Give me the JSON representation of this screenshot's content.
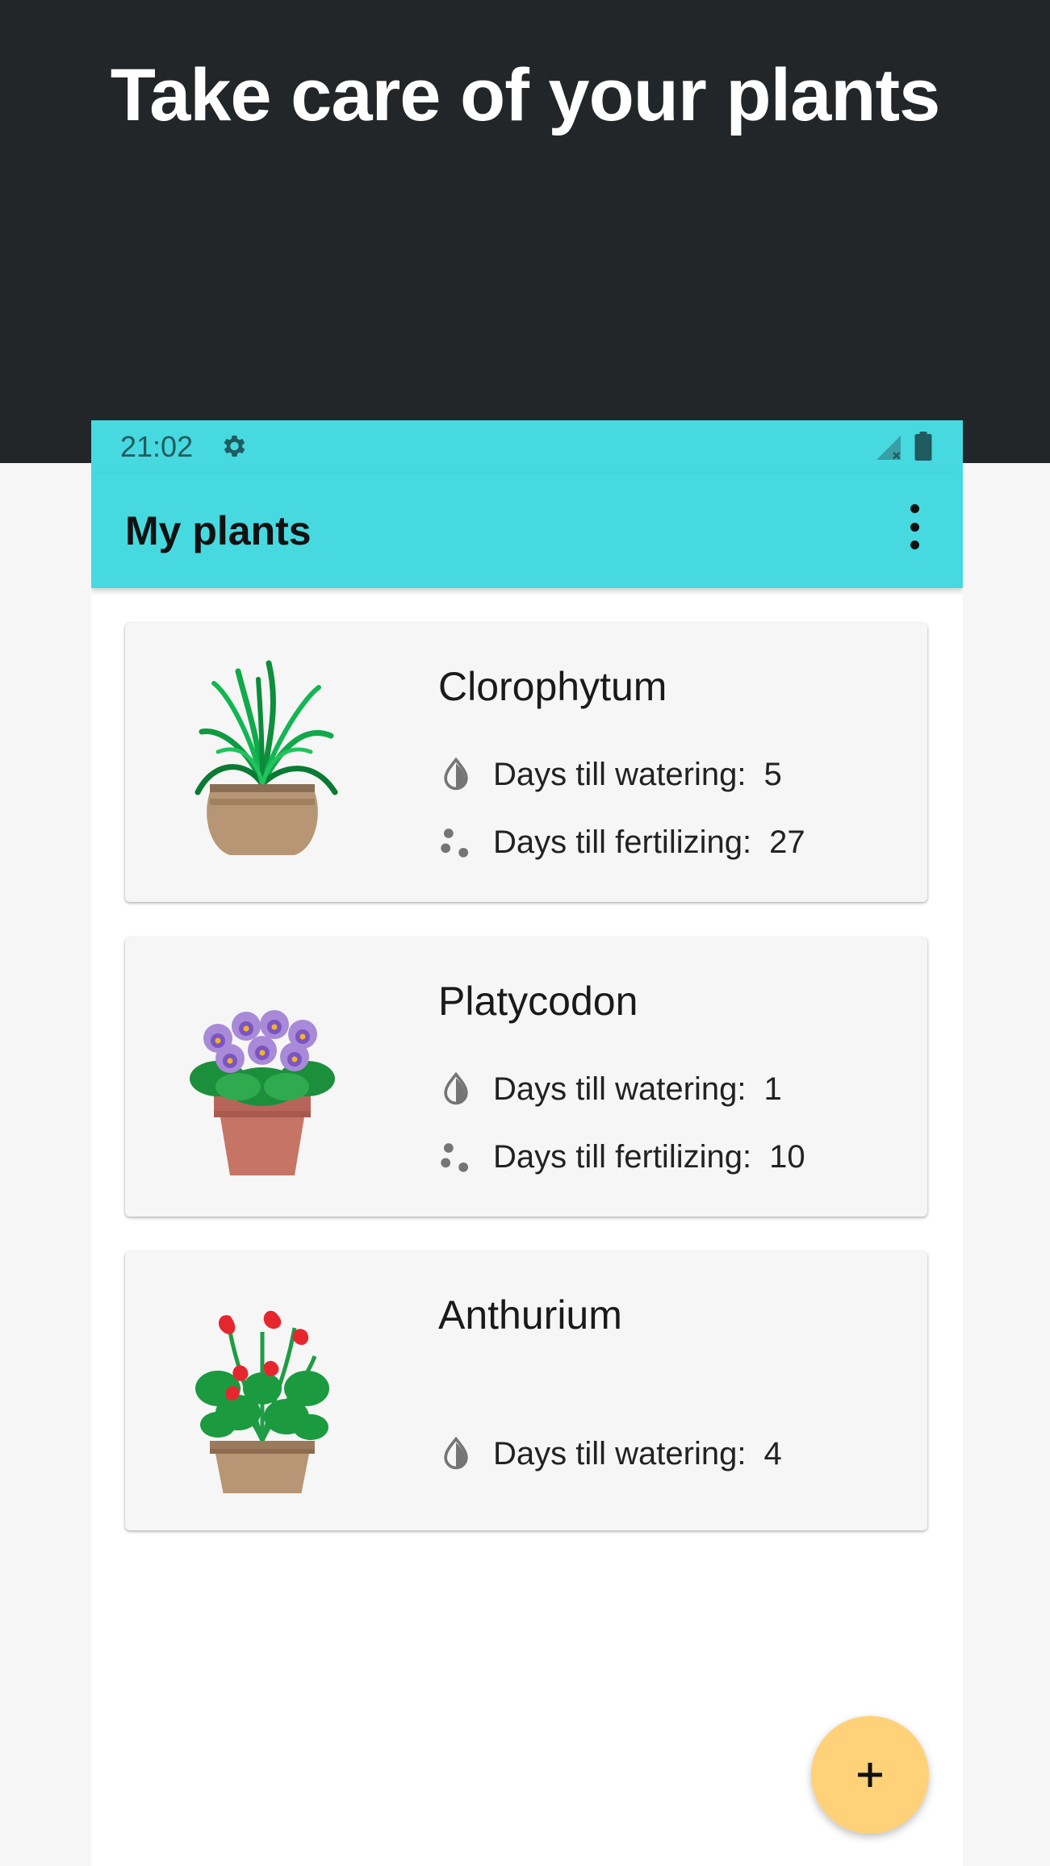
{
  "promo": {
    "headline": "Take care of your plants"
  },
  "status_bar": {
    "time": "21:02",
    "icons": [
      "gear-icon",
      "signal-icon",
      "battery-icon"
    ]
  },
  "app_bar": {
    "title": "My plants",
    "menu_icon": "more-vert-icon"
  },
  "colors": {
    "app_bar": "#47d9e0",
    "fab": "#ffd27a",
    "promo_background": "#222628"
  },
  "plants": [
    {
      "name": "Clorophytum",
      "watering_label": "Days till watering:",
      "watering_days": "5",
      "fertilizing_label": "Days till fertilizing:",
      "fertilizing_days": "27"
    },
    {
      "name": "Platycodon",
      "watering_label": "Days till watering:",
      "watering_days": "1",
      "fertilizing_label": "Days till fertilizing:",
      "fertilizing_days": "10"
    },
    {
      "name": "Anthurium",
      "watering_label": "Days till watering:",
      "watering_days": "4"
    }
  ],
  "fab": {
    "icon": "plus-icon"
  }
}
